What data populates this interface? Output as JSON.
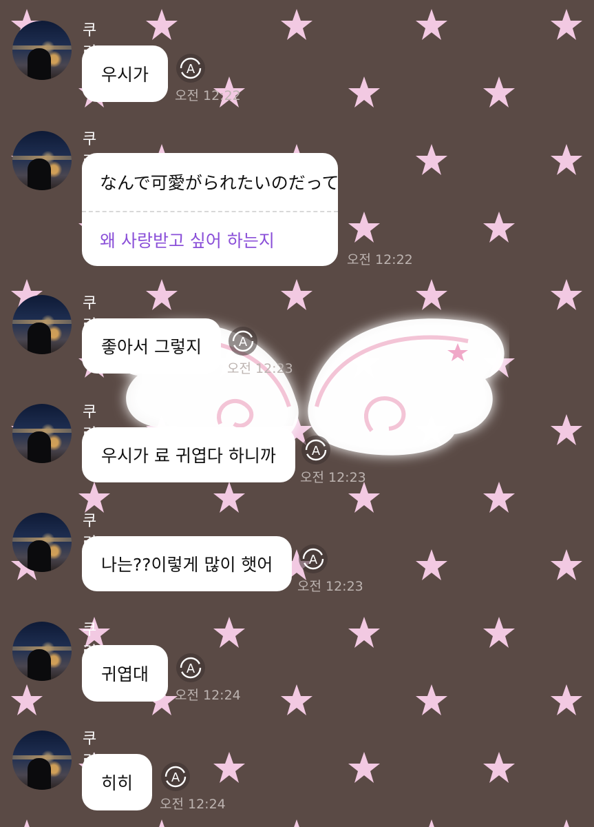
{
  "messages": [
    {
      "sender": "쿠리",
      "text": "우시가",
      "time": "오전 12:22"
    },
    {
      "sender": "쿠리",
      "text": "なんで可愛がられたいのだって",
      "translation": "왜 사랑받고 싶어 하는지",
      "time": "오전 12:22"
    },
    {
      "sender": "쿠리",
      "text": "좋아서 그렇지",
      "time": "오전 12:23"
    },
    {
      "sender": "쿠리",
      "text": "우시가 료 귀엽다 하니까",
      "time": "오전 12:23"
    },
    {
      "sender": "쿠리",
      "text": "나는??이렇게 많이 햇어",
      "time": "오전 12:23"
    },
    {
      "sender": "쿠리",
      "text": "귀엽대",
      "time": "오전 12:24"
    },
    {
      "sender": "쿠리",
      "text": "히히",
      "time": "오전 12:24"
    }
  ],
  "icons": {
    "translate": "translate-icon",
    "avatar": "profile-avatar",
    "sticker": "angel-wings-sticker"
  },
  "colors": {
    "background": "#5a4a45",
    "stars": "#f2c9e2",
    "bubble": "#ffffff",
    "translation_text": "#8a4fd8",
    "time_text": "#bdb4b1"
  }
}
